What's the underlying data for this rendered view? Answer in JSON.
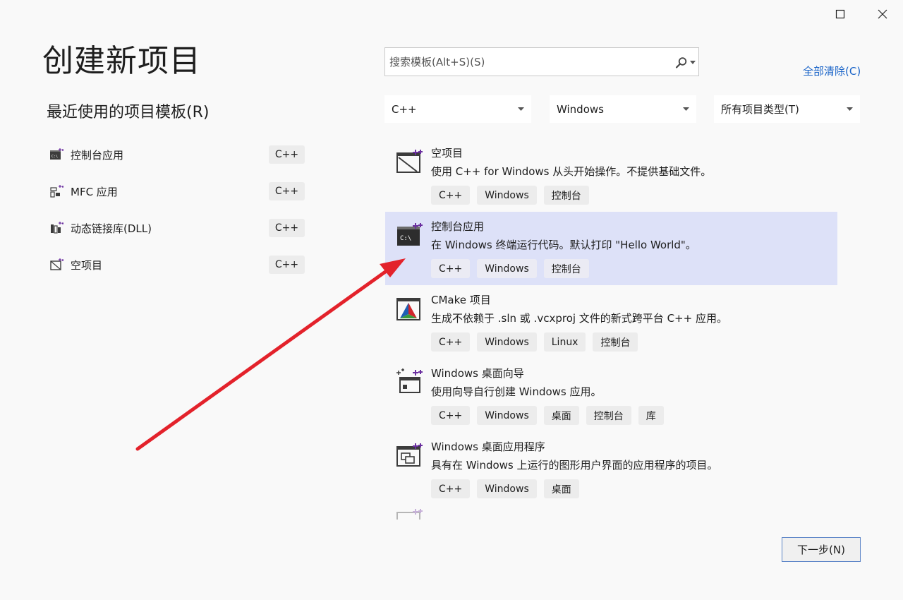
{
  "window": {
    "maximize_icon": "maximize-icon",
    "close_icon": "close-icon"
  },
  "page_title": "创建新项目",
  "recent": {
    "title": "最近使用的项目模板(R)",
    "items": [
      {
        "label": "控制台应用",
        "tag": "C++",
        "icon": "console-app-icon"
      },
      {
        "label": "MFC 应用",
        "tag": "C++",
        "icon": "mfc-app-icon"
      },
      {
        "label": "动态链接库(DLL)",
        "tag": "C++",
        "icon": "dll-icon"
      },
      {
        "label": "空项目",
        "tag": "C++",
        "icon": "empty-project-icon"
      }
    ]
  },
  "search": {
    "placeholder": "搜索模板(Alt+S)(S)",
    "value": ""
  },
  "clear_all": "全部清除(C)",
  "filters": {
    "language": "C++",
    "platform": "Windows",
    "project_type": "所有项目类型(T)"
  },
  "templates": [
    {
      "name": "空项目",
      "desc": "使用 C++ for Windows 从头开始操作。不提供基础文件。",
      "tags": [
        "C++",
        "Windows",
        "控制台"
      ],
      "icon": "empty-project-icon",
      "selected": false
    },
    {
      "name": "控制台应用",
      "desc": "在 Windows 终端运行代码。默认打印 \"Hello World\"。",
      "tags": [
        "C++",
        "Windows",
        "控制台"
      ],
      "icon": "console-app-icon",
      "selected": true
    },
    {
      "name": "CMake 项目",
      "desc": "生成不依赖于 .sln 或 .vcxproj 文件的新式跨平台 C++ 应用。",
      "tags": [
        "C++",
        "Windows",
        "Linux",
        "控制台"
      ],
      "icon": "cmake-icon",
      "selected": false
    },
    {
      "name": "Windows 桌面向导",
      "desc": "使用向导自行创建 Windows 应用。",
      "tags": [
        "C++",
        "Windows",
        "桌面",
        "控制台",
        "库"
      ],
      "icon": "wizard-icon",
      "selected": false
    },
    {
      "name": "Windows 桌面应用程序",
      "desc": "具有在 Windows 上运行的图形用户界面的应用程序的项目。",
      "tags": [
        "C++",
        "Windows",
        "桌面"
      ],
      "icon": "desktop-app-icon",
      "selected": false
    }
  ],
  "next_button": "下一步(N)",
  "colors": {
    "selected_bg": "#dde1f8",
    "link": "#1a64c8",
    "arrow": "#e3222b",
    "accent_purple": "#6b2fa0"
  }
}
